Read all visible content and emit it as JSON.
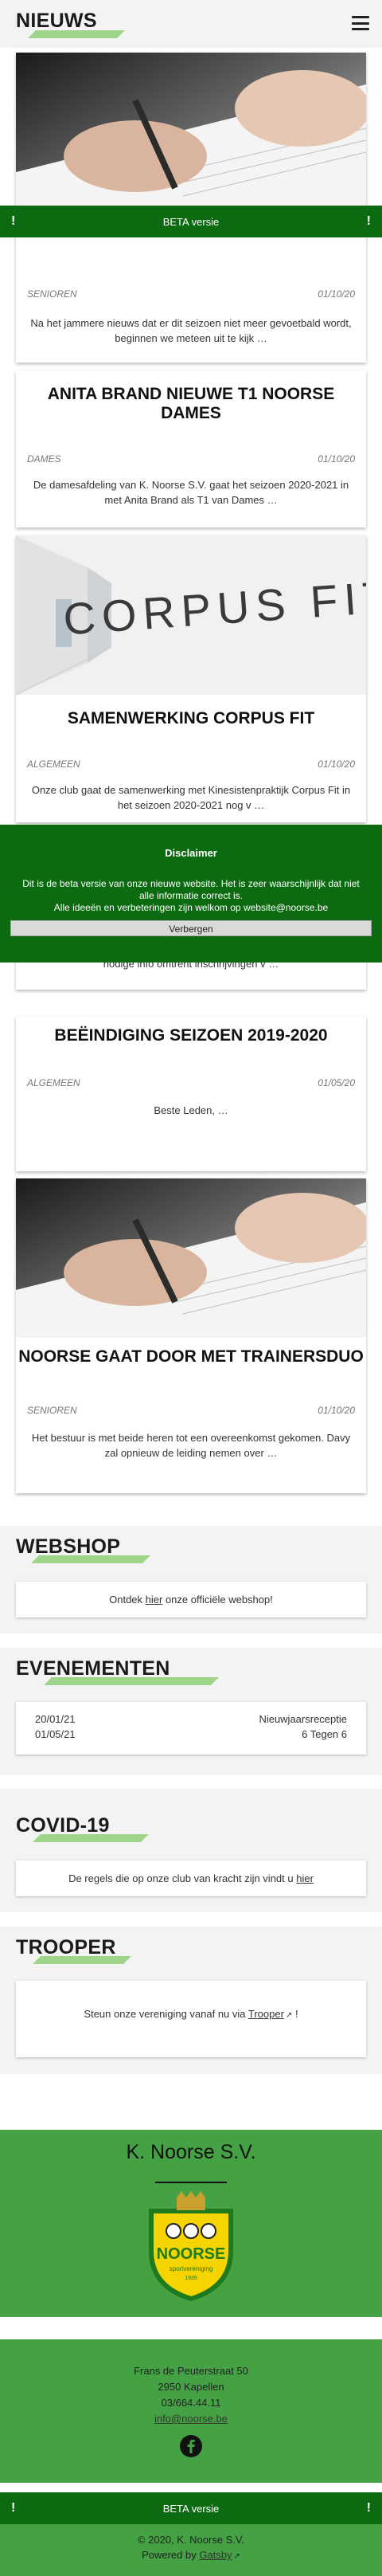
{
  "header": {
    "title": "NIEUWS"
  },
  "beta_banner": {
    "label": "BETA versie",
    "icon_left": "!",
    "icon_right": "!"
  },
  "news": [
    {
      "title": "",
      "category": "SENIOREN",
      "date": "01/10/20",
      "excerpt": "Na het jammere nieuws dat er dit seizoen niet meer gevoetbald wordt, beginnen we meteen uit te kijk …",
      "image": "pen-writing-contract"
    },
    {
      "title": "ANITA BRAND NIEUWE T1 NOORSE DAMES",
      "category": "DAMES",
      "date": "01/10/20",
      "excerpt": "De damesafdeling van K. Noorse S.V. gaat het seizoen 2020-2021 in met Anita Brand als T1 van Dames …"
    },
    {
      "title": "SAMENWERKING CORPUS FIT",
      "category": "ALGEMEEN",
      "date": "01/10/20",
      "excerpt": "Onze club gaat de samenwerking met Kinesistenpraktijk Corpus Fit in het seizoen 2020-2021 nog v …",
      "image": "corpus-fit-hallway",
      "image_text": "CORPUS FIT"
    },
    {
      "title": "",
      "category": "",
      "date": "",
      "excerpt": "nodige info omtrent inschrijvingen v …"
    },
    {
      "title": "BEËINDIGING SEIZOEN 2019-2020",
      "category": "ALGEMEEN",
      "date": "01/05/20",
      "excerpt": "Beste Leden,    …"
    },
    {
      "title": "NOORSE GAAT DOOR MET TRAINERSDUO",
      "category": "SENIOREN",
      "date": "01/10/20",
      "excerpt": "Het bestuur is met beide heren tot een overeenkomst gekomen. Davy zal opnieuw de leiding nemen over …",
      "image": "pen-writing-contract"
    }
  ],
  "disclaimer": {
    "title": "Disclaimer",
    "line1": "Dit is de beta versie van onze nieuwe website. Het is zeer waarschijnlijk dat niet alle informatie correct is.",
    "line2": "Alle ideeën en verbeteringen zijn welkom op website@noorse.be",
    "button": "Verbergen"
  },
  "webshop": {
    "title": "WEBSHOP",
    "text_before": "Ontdek ",
    "link": "hier",
    "text_after": " onze officiële webshop!"
  },
  "events": {
    "title": "EVENEMENTEN",
    "items": [
      {
        "date": "20/01/21",
        "name": "Nieuwjaarsreceptie"
      },
      {
        "date": "01/05/21",
        "name": "6 Tegen 6"
      }
    ]
  },
  "covid": {
    "title": "COVID-19",
    "text": "De regels die op onze club van kracht zijn vindt u ",
    "link": "hier"
  },
  "trooper": {
    "title": "TROOPER",
    "text_before": "Steun onze vereniging vanaf nu via ",
    "link": "Trooper",
    "text_after": " !"
  },
  "footer": {
    "club_name": "K. Noorse S.V.",
    "logo_text": "NOORSE",
    "logo_subtext": "sportvereniging",
    "logo_year": "1935",
    "address": "Frans de Peuterstraat 50",
    "city": "2950 Kapellen",
    "phone": "03/664.44.11",
    "email": "info@noorse.be",
    "social_icon": "facebook-icon",
    "copyright": "© 2020, K. Noorse S.V.",
    "powered_prefix": "Powered by ",
    "powered_link": "Gatsby"
  },
  "colors": {
    "dark_green": "#0c6b11",
    "green": "#44a244",
    "accent_bar": "#9fd48b",
    "gray_bg": "#f3f3f3"
  }
}
